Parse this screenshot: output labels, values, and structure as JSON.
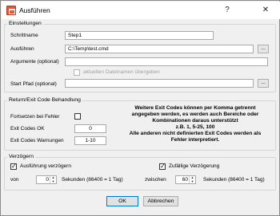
{
  "window": {
    "title": "Ausführen",
    "help_label": "?",
    "close_label": "✕"
  },
  "einstellungen": {
    "group_label": "Einstellungen",
    "schrittname_label": "Schrittname",
    "schrittname_value": "Step1",
    "ausfuehren_label": "Ausführen",
    "ausfuehren_value": "C:\\Temp\\test.cmd",
    "browse_label": "...",
    "argumente_label": "Argumente (optional)",
    "argumente_value": "",
    "aktuelle_dateinamen_label": "aktuellen Dateinamen übergeben",
    "startpfad_label": "Start Pfad (optional)",
    "startpfad_value": ""
  },
  "return_group": {
    "group_label": "Return/Exit Code Behandlung",
    "fortsetzen_label": "Fortsetzen bei Fehler",
    "exit_ok_label": "Exit Codes OK",
    "exit_ok_value": "0",
    "exit_warn_label": "Exit Codes Warnungen",
    "exit_warn_value": "1-10",
    "info_lines": [
      "Weitere Exit Codes können per Komma getrennt",
      "angegeben werden, es werden auch Bereiche oder",
      "Kombinationen daraus unterstützt",
      "z.B. 1, 5-25, 100",
      "Alle anderen nicht definierten Exit Codes werden als",
      "Fehler interpretiert."
    ]
  },
  "verzoegern": {
    "group_label": "Verzögern",
    "ausfuehrung_label": "Ausführung verzögern",
    "zufaellige_label": "Zufällige Verzögerung",
    "von_label": "von",
    "von_value": "0",
    "sekunden_label_1": "Sekunden (86400 = 1 Tag)",
    "zwischen_label": "zwischen",
    "zwischen_value": "60",
    "sekunden_label_2": "Sekunden (86400 = 1 Tag)"
  },
  "footer": {
    "ok_label": "OK",
    "abbrechen_label": "Abbrechen"
  }
}
